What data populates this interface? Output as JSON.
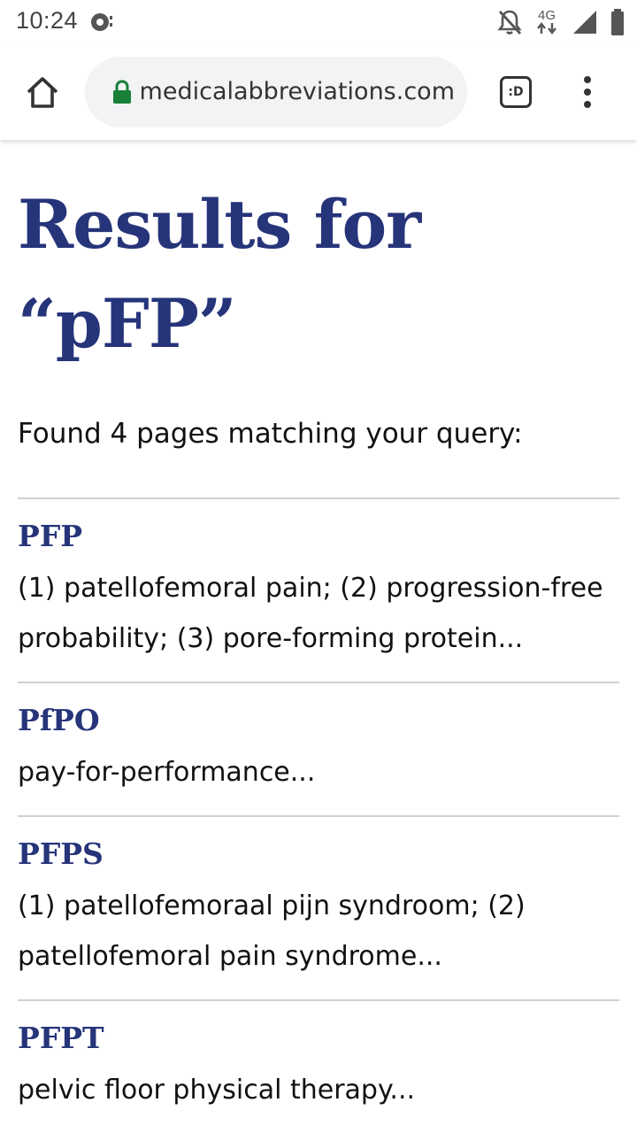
{
  "status_bar": {
    "time": "10:24",
    "network_label": "4G",
    "icons": [
      "notification-dot-icon",
      "bell-off-icon",
      "4g-data-icon",
      "signal-icon",
      "battery-icon"
    ]
  },
  "browser": {
    "url": "medicalabbreviations.com",
    "tab_switcher_label": ":D",
    "icons": [
      "home-icon",
      "lock-icon",
      "overflow-menu-icon"
    ],
    "colors": {
      "lock": "#188038",
      "url_bar_bg": "#f1f3f4"
    }
  },
  "page": {
    "title": "Results for “pFP”",
    "summary": "Found 4 pages matching your query:",
    "colors": {
      "title": "#26347a",
      "divider": "#d0d0d0"
    },
    "results": [
      {
        "title": "PFP",
        "description": "(1) patellofemoral pain; (2) progression-free probability; (3) pore-forming protein..."
      },
      {
        "title": "PfPO",
        "description": "pay-for-performance..."
      },
      {
        "title": "PFPS",
        "description": "(1) patellofemoraal pijn syndroom; (2) patellofemoral pain syndrome..."
      },
      {
        "title": "PFPT",
        "description": "pelvic floor physical therapy..."
      }
    ]
  }
}
